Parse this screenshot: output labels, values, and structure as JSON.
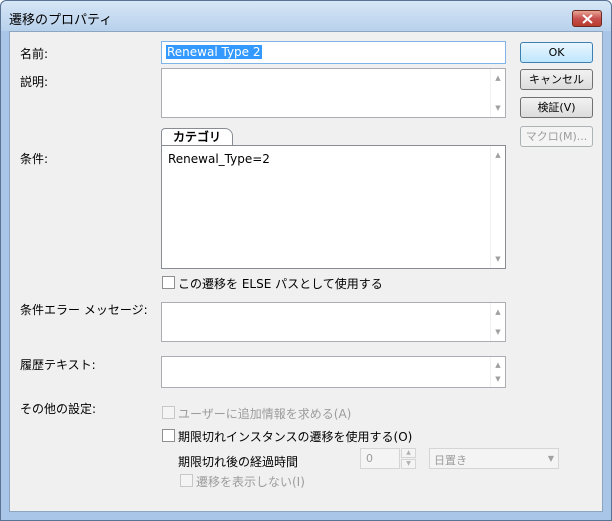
{
  "window": {
    "title": "遷移のプロパティ"
  },
  "labels": {
    "name": "名前:",
    "description": "説明:",
    "condition": "条件:",
    "condition_error": "条件エラー メッセージ:",
    "history": "履歴テキスト:",
    "other": "その他の設定:",
    "elapsed": "期限切れ後の経過時間"
  },
  "fields": {
    "name_value": "Renewal Type 2",
    "condition_tab": "カテゴリ",
    "condition_value": "Renewal_Type=2"
  },
  "buttons": {
    "ok": "OK",
    "cancel": "キャンセル",
    "verify": "検証(V)",
    "macro": "マクロ(M)..."
  },
  "checkboxes": {
    "else_path": "この遷移を ELSE パスとして使用する",
    "ask_user": "ユーザーに追加情報を求める(A)",
    "expired": "期限切れインスタンスの遷移を使用する(O)",
    "hide": "遷移を表示しない(I)"
  },
  "elapsed": {
    "value": "0",
    "unit": "日置き"
  },
  "icons": {
    "close": "close-icon",
    "scroll_up": "scroll-up-icon",
    "scroll_down": "scroll-down-icon",
    "dropdown": "chevron-down-icon"
  }
}
